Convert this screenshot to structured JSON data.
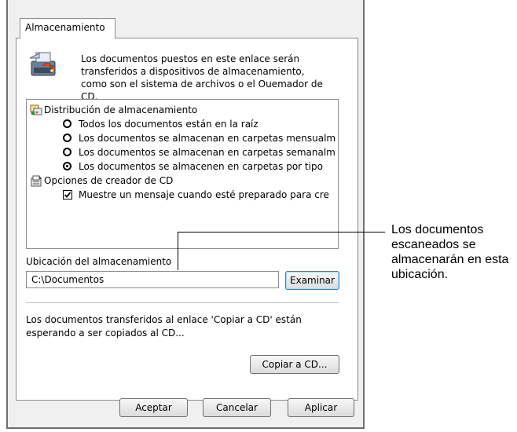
{
  "dialog": {
    "tab_label": "Almacenamiento",
    "icon": "storage-drive-icon",
    "description": "Los documentos puestos en este enlace serán transferidos a dispositivos de almacenamiento, como son el sistema de archivos o el Ouemador de CD.",
    "tree": {
      "distribution": {
        "label": "Distribución de almacenamiento",
        "icon": "storage-distribution-icon",
        "options": [
          {
            "label": "Todos los documentos están en la raíz",
            "selected": false
          },
          {
            "label": "Los documentos se almacenan en carpetas mensualm",
            "selected": false
          },
          {
            "label": "Los documentos se almacenan en carpetas semanalm",
            "selected": false
          },
          {
            "label": "Los documentos se almacenen en carpetas por tipo",
            "selected": true
          }
        ]
      },
      "cd_options": {
        "label": "Opciones de creador de CD",
        "icon": "cd-options-icon",
        "checkbox": {
          "label": "Muestre un mensaje cuando esté preparado para cre",
          "checked": true
        }
      }
    },
    "location_label": "Ubicación del almacenamiento",
    "location_value": "C:\\Documentos",
    "browse_button": "Examinar",
    "pending_text": "Los documentos transferidos al enlace 'Copiar a CD' están esperando a ser copiados al CD...",
    "copy_button": "Copiar a CD...",
    "ok_button": "Aceptar",
    "cancel_button": "Cancelar",
    "apply_button": "Aplicar"
  },
  "callout": {
    "text": "Los documentos escaneados se almacenarán en esta ubicación."
  }
}
